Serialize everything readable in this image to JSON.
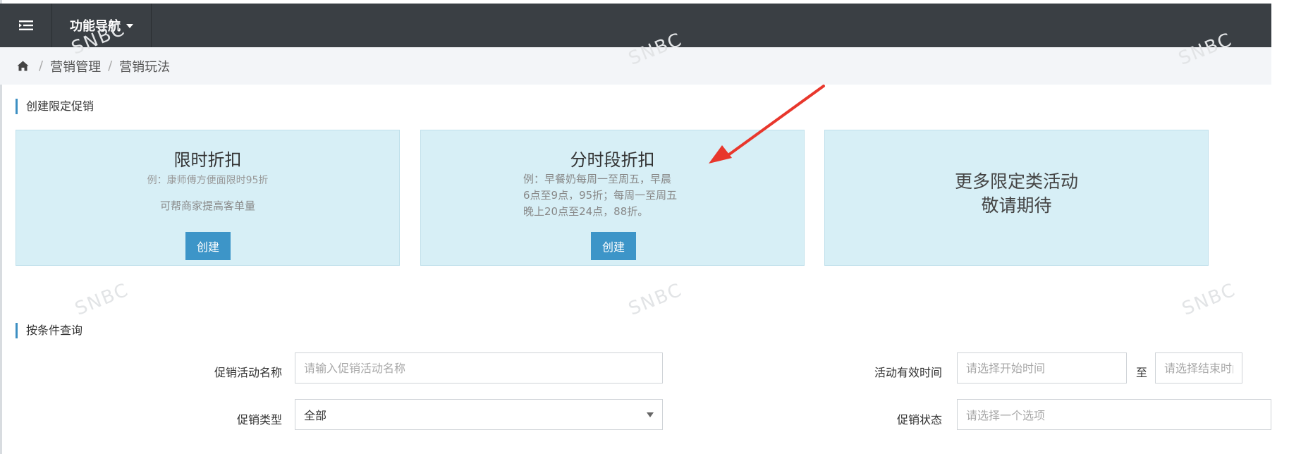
{
  "header": {
    "menu_icon": "menu-toggle-icon",
    "nav_label": "功能导航"
  },
  "breadcrumb": {
    "home_icon": "home-icon",
    "items": [
      "营销管理",
      "营销玩法"
    ]
  },
  "create_section": {
    "title": "创建限定促销",
    "cards": [
      {
        "title": "限时折扣",
        "desc": "例：康师傅方便面限时95折",
        "desc2": "可帮商家提高客单量",
        "button": "创建"
      },
      {
        "title": "分时段折扣",
        "desc_lines": [
          "例：早餐奶每周一至周五，早晨",
          "6点至9点，95折；每周一至周五",
          "晚上20点至24点，88折。"
        ],
        "button": "创建"
      },
      {
        "title_lines": [
          "更多限定类活动",
          "敬请期待"
        ]
      }
    ]
  },
  "query_section": {
    "title": "按条件查询",
    "name_label": "促销活动名称",
    "name_placeholder": "请输入促销活动名称",
    "time_label": "活动有效时间",
    "start_placeholder": "请选择开始时间",
    "to_label": "至",
    "end_placeholder": "请选择结束时间",
    "type_label": "促销类型",
    "type_value": "全部",
    "status_label": "促销状态",
    "status_placeholder": "请选择一个选项"
  },
  "watermark_text": "SNBC",
  "colors": {
    "topbar": "#3a3f44",
    "breadcrumb_bg": "#f3f5f8",
    "card_bg": "#d7eff6",
    "button": "#3d95c8",
    "accent": "#3d8fc2",
    "annotation_arrow": "#e8372c"
  }
}
